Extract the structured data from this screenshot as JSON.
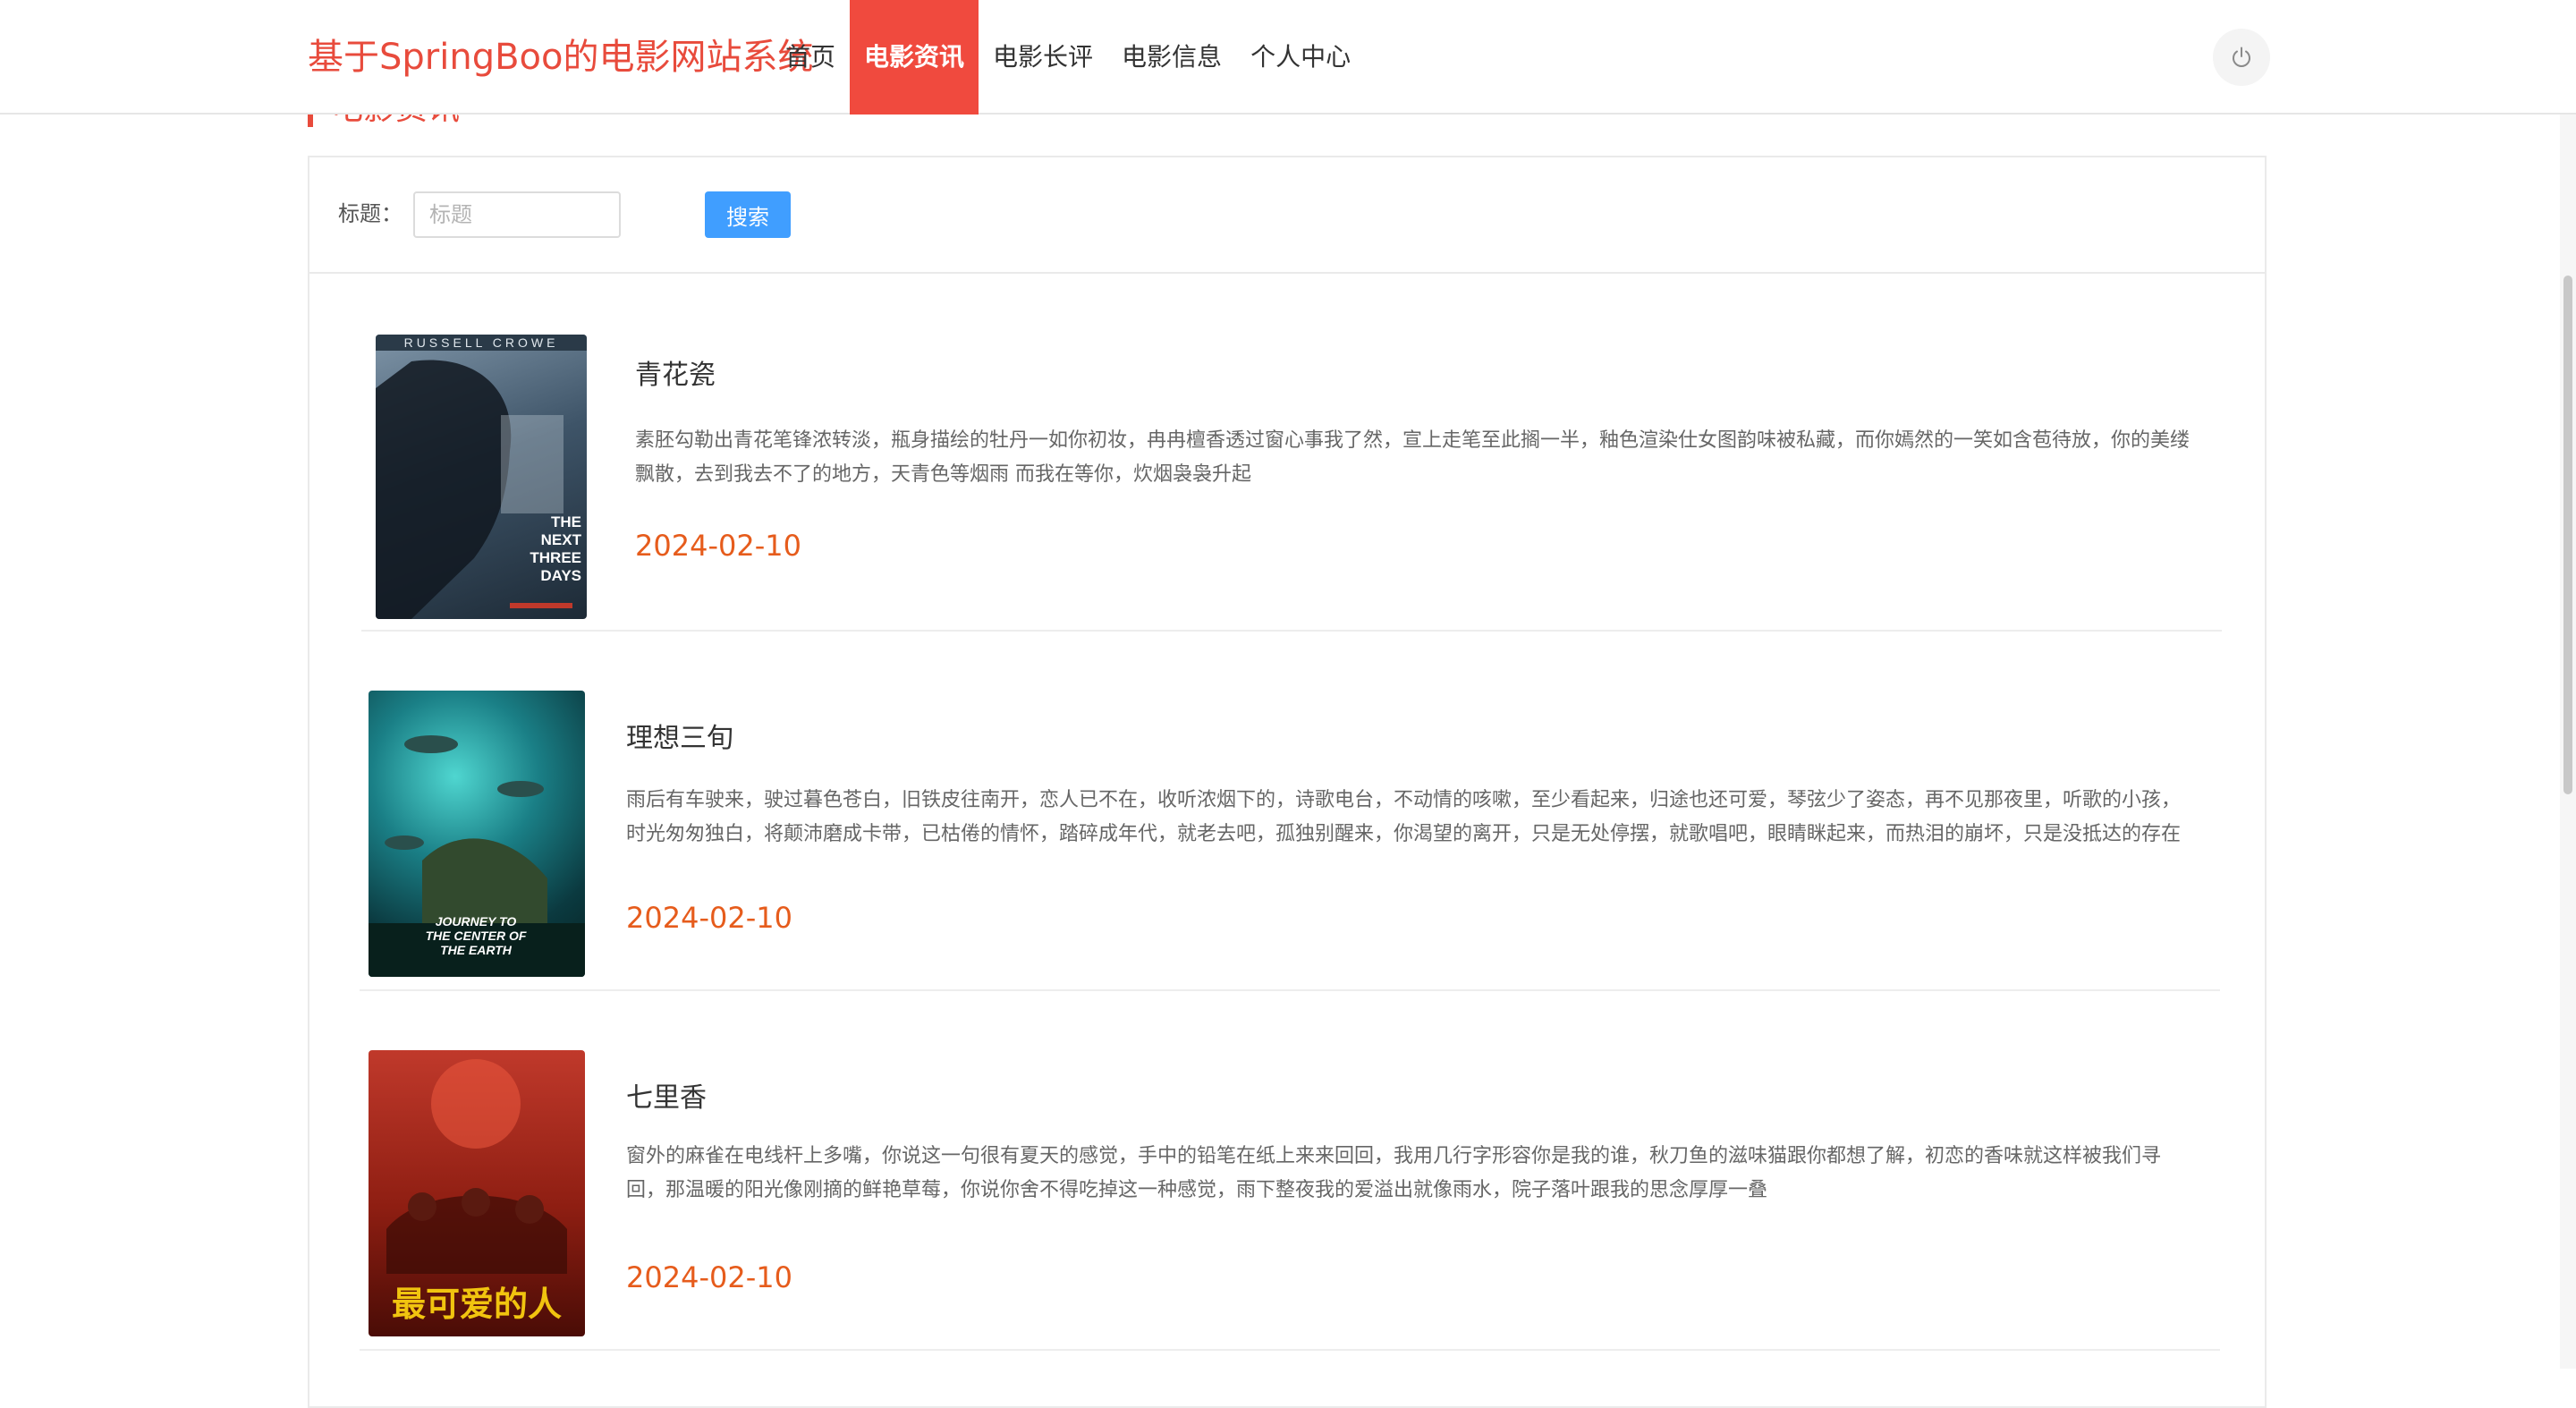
{
  "brand": "基于SpringBoo的电影网站系统",
  "nav": {
    "items": [
      {
        "label": "首页",
        "active": false
      },
      {
        "label": "电影资讯",
        "active": true
      },
      {
        "label": "电影长评",
        "active": false
      },
      {
        "label": "电影信息",
        "active": false
      },
      {
        "label": "个人中心",
        "active": false
      }
    ]
  },
  "header": {
    "logout_icon": "power-icon"
  },
  "section": {
    "heading": "电影资讯"
  },
  "search": {
    "label": "标题：",
    "placeholder": "标题",
    "value": "",
    "button": "搜索"
  },
  "colors": {
    "brand": "#e84b3c",
    "nav_active": "#f04a3e",
    "date": "#e65c1c",
    "button": "#409eff"
  },
  "news": [
    {
      "title": "青花瓷",
      "summary": "素胚勾勒出青花笔锋浓转淡，瓶身描绘的牡丹一如你初妆，冉冉檀香透过窗心事我了然，宣上走笔至此搁一半，釉色渲染仕女图韵味被私藏，而你嫣然的一笑如含苞待放，你的美缕飘散，去到我去不了的地方，天青色等烟雨 而我在等你，炊烟袅袅升起",
      "date": "2024-02-10",
      "poster_text": [
        "RUSSELL CROWE",
        "THE NEXT THREE DAYS"
      ]
    },
    {
      "title": "理想三旬",
      "summary": "雨后有车驶来，驶过暮色苍白，旧铁皮往南开，恋人已不在，收听浓烟下的，诗歌电台，不动情的咳嗽，至少看起来，归途也还可爱，琴弦少了姿态，再不见那夜里，听歌的小孩，时光匆匆独白，将颠沛磨成卡带，已枯倦的情怀，踏碎成年代，就老去吧，孤独别醒来，你渴望的离开，只是无处停摆，就歌唱吧，眼睛眯起来，而热泪的崩坏，只是没抵达的存在",
      "date": "2024-02-10",
      "poster_text": [
        "JOURNEY TO THE CENTER OF THE EARTH"
      ]
    },
    {
      "title": "七里香",
      "summary": "窗外的麻雀在电线杆上多嘴，你说这一句很有夏天的感觉，手中的铅笔在纸上来来回回，我用几行字形容你是我的谁，秋刀鱼的滋味猫跟你都想了解，初恋的香味就这样被我们寻回，那温暖的阳光像刚摘的鲜艳草莓，你说你舍不得吃掉这一种感觉，雨下整夜我的爱溢出就像雨水，院子落叶跟我的思念厚厚一叠",
      "date": "2024-02-10",
      "poster_text": [
        "最可爱的人"
      ]
    }
  ]
}
